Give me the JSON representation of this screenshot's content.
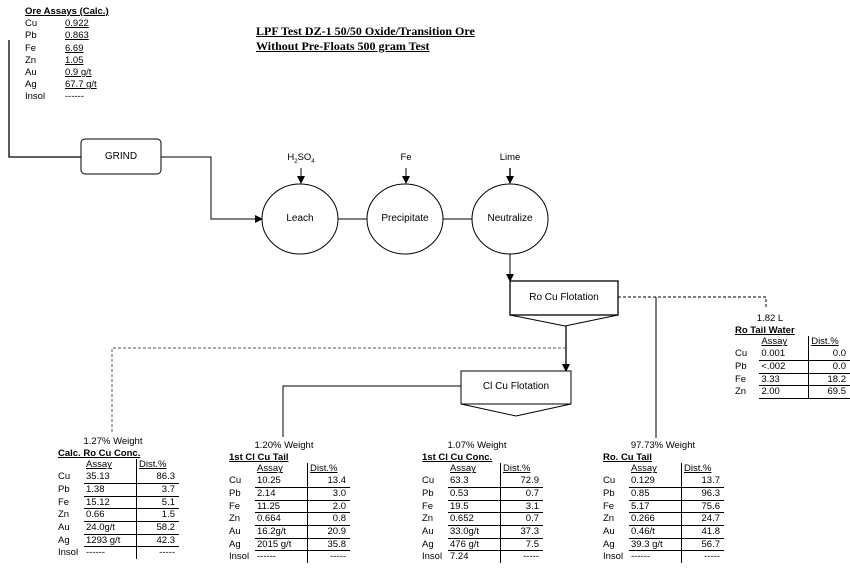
{
  "title": {
    "line1": "LPF Test DZ-1 50/50 Oxide/Transition Ore",
    "line2": "Without Pre-Floats 500 gram Test"
  },
  "ore_assays": {
    "header": "Ore Assays (Calc.)",
    "rows": [
      {
        "element": "Cu",
        "value": "0.922"
      },
      {
        "element": "Pb",
        "value": "0.863"
      },
      {
        "element": "Fe",
        "value": "6.69"
      },
      {
        "element": "Zn",
        "value": "1.05"
      },
      {
        "element": "Au",
        "value": "0.9 g/t"
      },
      {
        "element": "Ag",
        "value": "67.7 g/t"
      },
      {
        "element": "Insol",
        "value": "------"
      }
    ]
  },
  "nodes": {
    "grind": "GRIND",
    "leach": "Leach",
    "precipitate": "Precipitate",
    "neutralize": "Neutralize",
    "ro_cu_flotation": "Ro Cu Flotation",
    "cl_cu_flotation": "Cl Cu Flotation"
  },
  "reagents": {
    "leach_main": "H",
    "leach_sub1": "2",
    "leach_mid": "SO",
    "leach_sub2": "4",
    "precipitate": "Fe",
    "neutralize": "Lime"
  },
  "products": {
    "ro_tail_water": {
      "weight": "1.82 L",
      "name": "Ro Tail Water",
      "col_assay": "Assay",
      "col_dist": "Dist.%",
      "rows": [
        {
          "element": "Cu",
          "assay": "0.001",
          "dist": "0.0"
        },
        {
          "element": "Pb",
          "assay": "<.002",
          "dist": "0.0"
        },
        {
          "element": "Fe",
          "assay": "3.33",
          "dist": "18.2"
        },
        {
          "element": "Zn",
          "assay": "2.00",
          "dist": "69.5"
        }
      ]
    },
    "calc_ro_cu_conc": {
      "weight": "1.27% Weight",
      "name": "Calc. Ro Cu Conc.",
      "col_assay": "Assay",
      "col_dist": "Dist.%",
      "rows": [
        {
          "element": "Cu",
          "assay": "35.13",
          "dist": "86.3"
        },
        {
          "element": "Pb",
          "assay": "1.38",
          "dist": "3.7"
        },
        {
          "element": "Fe",
          "assay": "15.12",
          "dist": "5.1"
        },
        {
          "element": "Zn",
          "assay": "0.66",
          "dist": "1.5"
        },
        {
          "element": "Au",
          "assay": "24.0g/t",
          "dist": "58.2"
        },
        {
          "element": "Ag",
          "assay": "1293 g/t",
          "dist": "42.3"
        },
        {
          "element": "Insol",
          "assay": "------",
          "dist": "-----"
        }
      ]
    },
    "first_cl_cu_tail": {
      "weight": "1.20% Weight",
      "name": "1st Cl Cu Tail",
      "col_assay": "Assay",
      "col_dist": "Dist.%",
      "rows": [
        {
          "element": "Cu",
          "assay": "10.25",
          "dist": "13.4"
        },
        {
          "element": "Pb",
          "assay": "2.14",
          "dist": "3.0"
        },
        {
          "element": "Fe",
          "assay": "11.25",
          "dist": "2.0"
        },
        {
          "element": "Zn",
          "assay": "0.664",
          "dist": "0.8"
        },
        {
          "element": "Au",
          "assay": "16.2g/t",
          "dist": "20.9"
        },
        {
          "element": "Ag",
          "assay": "2015 g/t",
          "dist": "35.8"
        },
        {
          "element": "Insol",
          "assay": "------",
          "dist": "-----"
        }
      ]
    },
    "first_cl_cu_conc": {
      "weight": "1.07% Weight",
      "name": "1st Cl Cu Conc.",
      "col_assay": "Assay",
      "col_dist": "Dist.%",
      "rows": [
        {
          "element": "Cu",
          "assay": "63.3",
          "dist": "72.9"
        },
        {
          "element": "Pb",
          "assay": "0.53",
          "dist": "0.7"
        },
        {
          "element": "Fe",
          "assay": "19.5",
          "dist": "3.1"
        },
        {
          "element": "Zn",
          "assay": "0.652",
          "dist": "0.7"
        },
        {
          "element": "Au",
          "assay": "33.0g/t",
          "dist": "37.3"
        },
        {
          "element": "Ag",
          "assay": "476 g/t",
          "dist": "7.5"
        },
        {
          "element": "Insol",
          "assay": "7.24",
          "dist": "-----"
        }
      ]
    },
    "ro_cu_tail": {
      "weight": "97.73% Weight",
      "name": "Ro. Cu Tail",
      "col_assay": "Assay",
      "col_dist": "Dist.%",
      "rows": [
        {
          "element": "Cu",
          "assay": "0.129",
          "dist": "13.7"
        },
        {
          "element": "Pb",
          "assay": "0.85",
          "dist": "96.3"
        },
        {
          "element": "Fe",
          "assay": "5.17",
          "dist": "75.6"
        },
        {
          "element": "Zn",
          "assay": "0.266",
          "dist": "24.7"
        },
        {
          "element": "Au",
          "assay": "0.46/t",
          "dist": "41.8"
        },
        {
          "element": "Ag",
          "assay": "39.3 g/t",
          "dist": "56.7"
        },
        {
          "element": "Insol",
          "assay": "------",
          "dist": "-----"
        }
      ]
    }
  }
}
